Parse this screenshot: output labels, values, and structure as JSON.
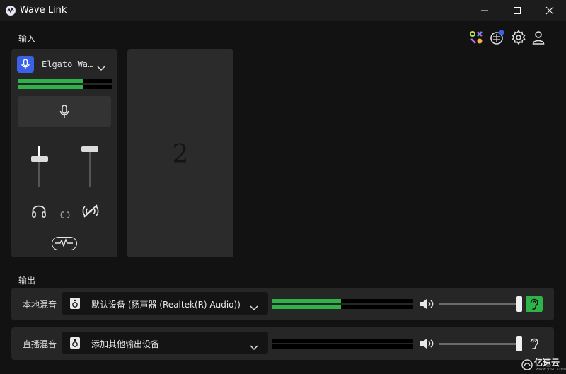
{
  "window": {
    "title": "Wave Link",
    "controls": {
      "minimize": "minimize",
      "maximize": "maximize",
      "close": "close"
    }
  },
  "colors": {
    "background": "#121212",
    "card": "#262626",
    "accent_green": "#2db34a",
    "device_badge": "#3a62e8"
  },
  "input_section": {
    "label": "输入",
    "channel": {
      "device_name": "Elgato Wa…",
      "meter_level": 0.69,
      "monitor_fader_level": 0.72,
      "stream_fader_level": 0.95
    },
    "empty_slot_number": "2"
  },
  "toolbar_icons": [
    "marketplace-icon",
    "plugin-notification-icon",
    "settings-icon",
    "account-icon"
  ],
  "output_section": {
    "label": "输出",
    "rows": [
      {
        "label": "本地混音",
        "device": "默认设备 (扬声器 (Realtek(R) Audio))",
        "meter_level": 0.49,
        "volume": 0.98,
        "listen_active": true
      },
      {
        "label": "直播混音",
        "device": "添加其他输出设备",
        "meter_level": 0,
        "volume": 0.98,
        "listen_active": false
      }
    ]
  },
  "watermark": {
    "text": "亿速云",
    "sub": "www.yisu.com"
  }
}
